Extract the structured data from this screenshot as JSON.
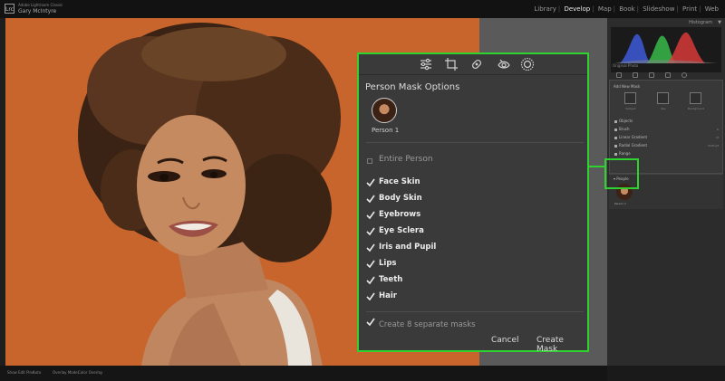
{
  "app": {
    "product": "Adobe Lightroom Classic",
    "user": "Gary McIntyre",
    "logo": "Lrc",
    "modules": [
      {
        "label": "Library",
        "active": false
      },
      {
        "label": "Develop",
        "active": true
      },
      {
        "label": "Map",
        "active": false
      },
      {
        "label": "Book",
        "active": false
      },
      {
        "label": "Slideshow",
        "active": false
      },
      {
        "label": "Print",
        "active": false
      },
      {
        "label": "Web",
        "active": false
      }
    ]
  },
  "right_panel": {
    "histogram_label": "Histogram",
    "original_photo": "Original Photo",
    "add_mask": {
      "label": "Add New Mask",
      "buttons": [
        "Subject",
        "Sky",
        "Background"
      ]
    },
    "tools": [
      {
        "label": "Objects",
        "key": ""
      },
      {
        "label": "Brush",
        "key": "K"
      },
      {
        "label": "Linear Gradient",
        "key": "M"
      },
      {
        "label": "Radial Gradient",
        "key": "Shift+M"
      },
      {
        "label": "Range",
        "key": ""
      }
    ],
    "people": {
      "label": "People",
      "person": "Person 1"
    },
    "buttons": {
      "previous": "Previous",
      "reset": "Reset"
    }
  },
  "bottom_bar": {
    "show_edit_pins": "Show Edit Pins:",
    "auto": "Auto",
    "overlay_mode": "Overlay Mode:",
    "color_overlay": "Color Overlay"
  },
  "dialog": {
    "title": "Person Mask Options",
    "person_label": "Person 1",
    "entire_person": "Entire Person",
    "parts": [
      {
        "label": "Face Skin",
        "checked": true
      },
      {
        "label": "Body Skin",
        "checked": true
      },
      {
        "label": "Eyebrows",
        "checked": true
      },
      {
        "label": "Eye Sclera",
        "checked": true
      },
      {
        "label": "Iris and Pupil",
        "checked": true
      },
      {
        "label": "Lips",
        "checked": true
      },
      {
        "label": "Teeth",
        "checked": true
      },
      {
        "label": "Hair",
        "checked": true
      }
    ],
    "separate_masks": "Create 8 separate masks",
    "cancel": "Cancel",
    "create": "Create Mask"
  },
  "colors": {
    "highlight": "#2fd32f",
    "photo_background": "#c8652c"
  }
}
